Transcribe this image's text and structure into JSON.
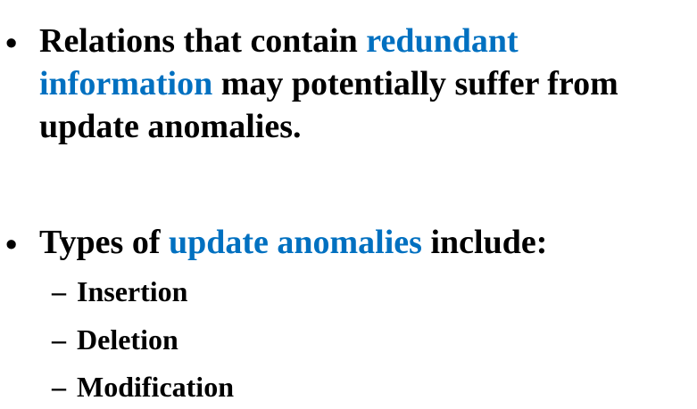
{
  "bullets": [
    {
      "marker": "•",
      "line1": {
        "a": "Relations that contain ",
        "b": "redundant"
      },
      "line2": {
        "a": "information",
        "b": " may potentially suffer from"
      },
      "line3": "update anomalies."
    },
    {
      "marker": "•",
      "line1": {
        "a": "Types of ",
        "b": "update anomalies",
        "c": " include:"
      }
    }
  ],
  "subitems": [
    {
      "dash": "–",
      "label": "Insertion"
    },
    {
      "dash": "–",
      "label": "Deletion"
    },
    {
      "dash": "–",
      "label": "Modification"
    }
  ],
  "colors": {
    "text": "#000000",
    "highlight": "#0070c0",
    "background": "#ffffff"
  }
}
